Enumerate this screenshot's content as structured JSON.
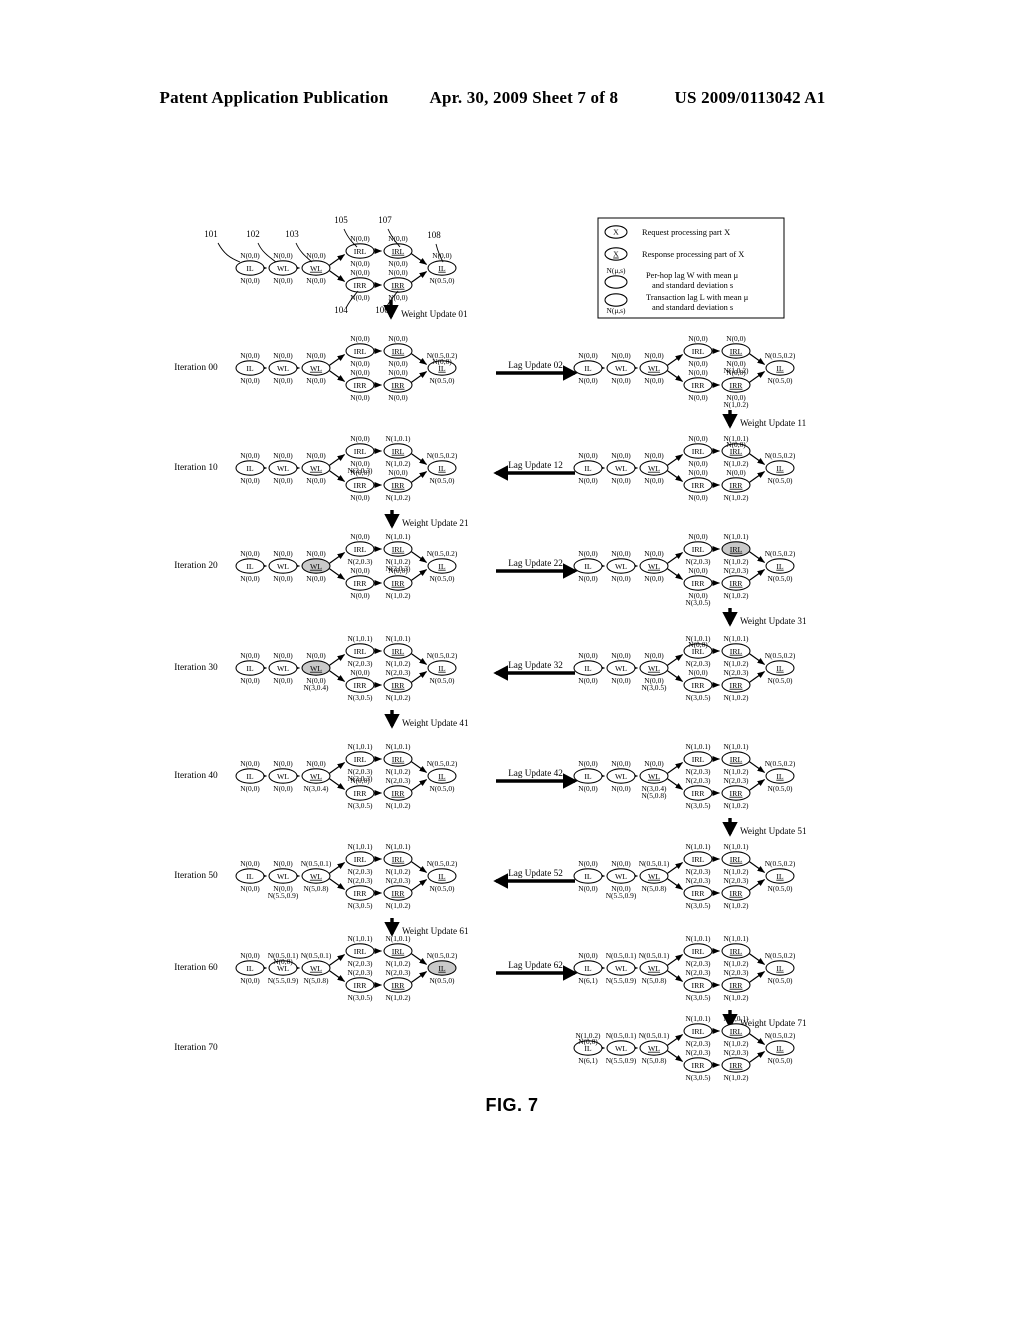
{
  "header": {
    "left": "Patent Application Publication",
    "middle": "Apr. 30, 2009  Sheet 7 of 8",
    "right": "US 2009/0113042 A1"
  },
  "figure": {
    "caption": "FIG. 7"
  },
  "legend": {
    "items": [
      {
        "glyph": "X",
        "underlined": false,
        "text": "Request processing part X"
      },
      {
        "glyph": "X",
        "underlined": true,
        "text": "Response processing part of X"
      },
      {
        "top_label": "N(μ,s)",
        "bottom_label": "",
        "text_line1": "Per-hop lag W with mean μ",
        "text_line2": "and standard deviation s"
      },
      {
        "top_label": "",
        "bottom_label": "N(μ,s)",
        "text_line1": "Transaction lag L with mean μ",
        "text_line2": "and standard deviation s"
      }
    ]
  },
  "reference_numerals": [
    "101",
    "102",
    "103",
    "104",
    "105",
    "106",
    "107",
    "108"
  ],
  "node_labels": {
    "il": "IL",
    "wl": "WL",
    "irl": "IRL",
    "irr": "IRR"
  },
  "updates": {
    "weight": [
      "Weight Update 01",
      "Weight Update 11",
      "Weight Update 21",
      "Weight Update 31",
      "Weight Update 41",
      "Weight Update 51",
      "Weight Update 61",
      "Weight Update 71"
    ],
    "lag": [
      {
        "label": "Lag Update 02",
        "direction": "right"
      },
      {
        "label": "Lag Update 12",
        "direction": "left"
      },
      {
        "label": "Lag Update 22",
        "direction": "right"
      },
      {
        "label": "Lag Update 32",
        "direction": "left"
      },
      {
        "label": "Lag Update 42",
        "direction": "right"
      },
      {
        "label": "Lag Update 52",
        "direction": "left"
      },
      {
        "label": "Lag Update 62",
        "direction": "right"
      }
    ]
  },
  "iterations": [
    {
      "label": "Iteration 00"
    },
    {
      "label": "Iteration 10"
    },
    {
      "label": "Iteration 20"
    },
    {
      "label": "Iteration 30"
    },
    {
      "label": "Iteration 40"
    },
    {
      "label": "Iteration 50"
    },
    {
      "label": "Iteration 60"
    },
    {
      "label": "Iteration 70"
    }
  ],
  "graphs": {
    "top": {
      "name": "initial-graph",
      "nodes": [
        {
          "id": "il1",
          "label": "IL",
          "top": "N(0,0)",
          "bottom": "N(0,0)",
          "underline": false,
          "shaded": false
        },
        {
          "id": "wl1",
          "label": "WL",
          "top": "N(0,0)",
          "bottom": "N(0,0)",
          "underline": false,
          "shaded": false
        },
        {
          "id": "wl2",
          "label": "WL",
          "top": "N(0,0)",
          "bottom": "N(0,0)",
          "underline": true,
          "shaded": false
        },
        {
          "id": "irl1",
          "label": "IRL",
          "top": "N(0,0)",
          "bottom": "N(0,0)",
          "underline": false,
          "shaded": false
        },
        {
          "id": "irl2",
          "label": "IRL",
          "top": "N(0,0)",
          "bottom": "N(0,0)",
          "underline": true,
          "shaded": false
        },
        {
          "id": "irr1",
          "label": "IRR",
          "top": "N(0,0)",
          "bottom": "N(0,0)",
          "underline": false,
          "shaded": false
        },
        {
          "id": "irr2",
          "label": "IRR",
          "top": "N(0,0)",
          "bottom": "N(0,0)",
          "underline": true,
          "shaded": false
        },
        {
          "id": "il2",
          "label": "IL",
          "top": "N(0,0)",
          "bottom": "N(0.5,0)",
          "underline": true,
          "shaded": false
        }
      ]
    },
    "rows": [
      {
        "iteration": "Iteration 00",
        "left": {
          "il1": {
            "top": "N(0,0)",
            "bottom": "N(0,0)"
          },
          "wl1": {
            "top": "N(0,0)",
            "bottom": "N(0,0)"
          },
          "wl2": {
            "top": "N(0,0)",
            "bottom": "N(0,0)"
          },
          "irl1": {
            "top": "N(0,0)",
            "bottom": "N(0,0)"
          },
          "irl2": {
            "top": "N(0,0)",
            "bottom": "N(0,0)"
          },
          "irr1": {
            "top": "N(0,0)",
            "bottom": "N(0,0)"
          },
          "irr2": {
            "top": "N(0,0)",
            "bottom": "N(0,0)"
          },
          "il2": {
            "top": "N(0.5,0.2)",
            "top2": "N(0,0)",
            "bottom": "N(0.5,0)"
          },
          "shaded": []
        },
        "right": {
          "il1": {
            "top": "N(0,0)",
            "bottom": "N(0,0)"
          },
          "wl1": {
            "top": "N(0,0)",
            "bottom": "N(0,0)"
          },
          "wl2": {
            "top": "N(0,0)",
            "bottom": "N(0,0)"
          },
          "irl1": {
            "top": "N(0,0)",
            "bottom": "N(0,0)"
          },
          "irl2": {
            "top": "N(0,0)",
            "bottom": "N(0,0)",
            "bottom2": "N(1,0.2)"
          },
          "irr1": {
            "top": "N(0,0)",
            "bottom": "N(0,0)"
          },
          "irr2": {
            "top": "N(0,0)",
            "bottom": "N(0,0)",
            "bottom2": "N(1,0.2)"
          },
          "il2": {
            "top": "N(0.5,0.2)",
            "bottom": "N(0.5,0)"
          },
          "shaded": []
        }
      },
      {
        "iteration": "Iteration 10",
        "left": {
          "il1": {
            "top": "N(0,0)",
            "bottom": "N(0,0)"
          },
          "wl1": {
            "top": "N(0,0)",
            "bottom": "N(0,0)"
          },
          "wl2": {
            "top": "N(0,0)",
            "bottom": "N(0,0)"
          },
          "irl1": {
            "top": "N(0,0)",
            "bottom": "N(0,0)",
            "bottom2": "N(2,0.3)"
          },
          "irl2": {
            "top": "N(1,0.1)",
            "bottom": "N(1,0.2)"
          },
          "irr1": {
            "top": "N(0,0)",
            "bottom": "N(0,0)"
          },
          "irr2": {
            "top": "N(0,0)",
            "bottom": "N(1,0.2)"
          },
          "il2": {
            "top": "N(0.5,0.2)",
            "bottom": "N(0.5,0)"
          },
          "shaded": []
        },
        "right": {
          "il1": {
            "top": "N(0,0)",
            "bottom": "N(0,0)"
          },
          "wl1": {
            "top": "N(0,0)",
            "bottom": "N(0,0)"
          },
          "wl2": {
            "top": "N(0,0)",
            "bottom": "N(0,0)"
          },
          "irl1": {
            "top": "N(0,0)",
            "bottom": "N(0,0)"
          },
          "irl2": {
            "top": "N(1,0.1)",
            "top2": "N(0,0)",
            "bottom": "N(1,0.2)"
          },
          "irr1": {
            "top": "N(0,0)",
            "bottom": "N(0,0)"
          },
          "irr2": {
            "top": "N(0,0)",
            "bottom": "N(1,0.2)"
          },
          "il2": {
            "top": "N(0.5,0.2)",
            "bottom": "N(0.5,0)"
          },
          "shaded": []
        }
      },
      {
        "iteration": "Iteration 20",
        "left": {
          "il1": {
            "top": "N(0,0)",
            "bottom": "N(0,0)"
          },
          "wl1": {
            "top": "N(0,0)",
            "bottom": "N(0,0)"
          },
          "wl2": {
            "top": "N(0,0)",
            "bottom": "N(0,0)"
          },
          "irl1": {
            "top": "N(0,0)",
            "bottom": "N(2,0.3)"
          },
          "irl2": {
            "top": "N(1,0.1)",
            "bottom": "N(1,0.2)",
            "bottom2": "N(2,0.3)"
          },
          "irr1": {
            "top": "N(0,0)",
            "bottom": "N(0,0)"
          },
          "irr2": {
            "top": "N(0,0)",
            "bottom": "N(1,0.2)"
          },
          "il2": {
            "top": "N(0.5,0.2)",
            "bottom": "N(0.5,0)"
          },
          "shaded": [
            "wl2"
          ]
        },
        "right": {
          "il1": {
            "top": "N(0,0)",
            "bottom": "N(0,0)"
          },
          "wl1": {
            "top": "N(0,0)",
            "bottom": "N(0,0)"
          },
          "wl2": {
            "top": "N(0,0)",
            "bottom": "N(0,0)"
          },
          "irl1": {
            "top": "N(0,0)",
            "bottom": "N(2,0.3)"
          },
          "irl2": {
            "top": "N(1,0.1)",
            "bottom": "N(1,0.2)"
          },
          "irr1": {
            "top": "N(0,0)",
            "bottom": "N(0,0)",
            "bottom2": "N(3,0.5)"
          },
          "irr2": {
            "top": "N(2,0.3)",
            "bottom": "N(1,0.2)"
          },
          "il2": {
            "top": "N(0.5,0.2)",
            "bottom": "N(0.5,0)"
          },
          "shaded": [
            "irl2"
          ]
        }
      },
      {
        "iteration": "Iteration 30",
        "left": {
          "il1": {
            "top": "N(0,0)",
            "bottom": "N(0,0)"
          },
          "wl1": {
            "top": "N(0,0)",
            "bottom": "N(0,0)"
          },
          "wl2": {
            "top": "N(0,0)",
            "bottom": "N(0,0)",
            "bottom2": "N(3,0.4)"
          },
          "irl1": {
            "top": "N(1,0.1)",
            "bottom": "N(2,0.3)"
          },
          "irl2": {
            "top": "N(1,0.1)",
            "bottom": "N(1,0.2)"
          },
          "irr1": {
            "top": "N(0,0)",
            "bottom": "N(3,0.5)"
          },
          "irr2": {
            "top": "N(2,0.3)",
            "bottom": "N(1,0.2)"
          },
          "il2": {
            "top": "N(0.5,0.2)",
            "bottom": "N(0.5,0)"
          },
          "shaded": [
            "wl2"
          ]
        },
        "right": {
          "il1": {
            "top": "N(0,0)",
            "bottom": "N(0,0)"
          },
          "wl1": {
            "top": "N(0,0)",
            "bottom": "N(0,0)"
          },
          "wl2": {
            "top": "N(0,0)",
            "bottom": "N(0,0)",
            "bottom2": "N(3,0.5)"
          },
          "irl1": {
            "top": "N(1,0.1)",
            "top2": "N(0,0)",
            "bottom": "N(2,0.3)"
          },
          "irl2": {
            "top": "N(1,0.1)",
            "bottom": "N(1,0.2)"
          },
          "irr1": {
            "top": "N(0,0)",
            "bottom": "N(3,0.5)"
          },
          "irr2": {
            "top": "N(2,0.3)",
            "bottom": "N(1,0.2)"
          },
          "il2": {
            "top": "N(0.5,0.2)",
            "bottom": "N(0.5,0)"
          },
          "shaded": []
        }
      },
      {
        "iteration": "Iteration 40",
        "left": {
          "il1": {
            "top": "N(0,0)",
            "bottom": "N(0,0)"
          },
          "wl1": {
            "top": "N(0,0)",
            "bottom": "N(0,0)"
          },
          "wl2": {
            "top": "N(0,0)",
            "bottom": "N(3,0.4)"
          },
          "irl1": {
            "top": "N(1,0.1)",
            "bottom": "N(2,0.3)",
            "bottom2": "N(2,0.3)"
          },
          "irl2": {
            "top": "N(1,0.1)",
            "bottom": "N(1,0.2)"
          },
          "irr1": {
            "top": "N(0,0)",
            "bottom": "N(3,0.5)"
          },
          "irr2": {
            "top": "N(2,0.3)",
            "bottom": "N(1,0.2)"
          },
          "il2": {
            "top": "N(0.5,0.2)",
            "bottom": "N(0.5,0)"
          },
          "shaded": []
        },
        "right": {
          "il1": {
            "top": "N(0,0)",
            "bottom": "N(0,0)"
          },
          "wl1": {
            "top": "N(0,0)",
            "bottom": "N(0,0)"
          },
          "wl2": {
            "top": "N(0,0)",
            "bottom": "N(3,0.4)",
            "bottom2": "N(5,0.8)"
          },
          "irl1": {
            "top": "N(1,0.1)",
            "bottom": "N(2,0.3)"
          },
          "irl2": {
            "top": "N(1,0.1)",
            "bottom": "N(1,0.2)"
          },
          "irr1": {
            "top": "N(2,0.3)",
            "bottom": "N(3,0.5)"
          },
          "irr2": {
            "top": "N(2,0.3)",
            "bottom": "N(1,0.2)"
          },
          "il2": {
            "top": "N(0.5,0.2)",
            "bottom": "N(0.5,0)"
          },
          "shaded": []
        }
      },
      {
        "iteration": "Iteration 50",
        "left": {
          "il1": {
            "top": "N(0,0)",
            "bottom": "N(0,0)"
          },
          "wl1": {
            "top": "N(0,0)",
            "bottom": "N(0,0)",
            "bottom2": "N(5.5,0.9)"
          },
          "wl2": {
            "top": "N(0.5,0.1)",
            "bottom": "N(5,0.8)"
          },
          "irl1": {
            "top": "N(1,0.1)",
            "bottom": "N(2,0.3)"
          },
          "irl2": {
            "top": "N(1,0.1)",
            "bottom": "N(1,0.2)"
          },
          "irr1": {
            "top": "N(2,0.3)",
            "bottom": "N(3,0.5)"
          },
          "irr2": {
            "top": "N(2,0.3)",
            "bottom": "N(1,0.2)"
          },
          "il2": {
            "top": "N(0.5,0.2)",
            "bottom": "N(0.5,0)"
          },
          "shaded": []
        },
        "right": {
          "il1": {
            "top": "N(0,0)",
            "bottom": "N(0,0)"
          },
          "wl1": {
            "top": "N(0,0)",
            "bottom": "N(0,0)",
            "bottom2": "N(5.5,0.9)"
          },
          "wl2": {
            "top": "N(0.5,0.1)",
            "bottom": "N(5,0.8)"
          },
          "irl1": {
            "top": "N(1,0.1)",
            "bottom": "N(2,0.3)"
          },
          "irl2": {
            "top": "N(1,0.1)",
            "bottom": "N(1,0.2)"
          },
          "irr1": {
            "top": "N(2,0.3)",
            "bottom": "N(3,0.5)"
          },
          "irr2": {
            "top": "N(2,0.3)",
            "bottom": "N(1,0.2)"
          },
          "il2": {
            "top": "N(0.5,0.2)",
            "bottom": "N(0.5,0)"
          },
          "shaded": []
        }
      },
      {
        "iteration": "Iteration 60",
        "left": {
          "il1": {
            "top": "N(0,0)",
            "bottom": "N(0,0)"
          },
          "wl1": {
            "top": "N(0.5,0.1)",
            "top2": "N(0,0)",
            "bottom": "N(5.5,0.9)"
          },
          "wl2": {
            "top": "N(0.5,0.1)",
            "bottom": "N(5,0.8)"
          },
          "irl1": {
            "top": "N(1,0.1)",
            "bottom": "N(2,0.3)"
          },
          "irl2": {
            "top": "N(1,0.1)",
            "bottom": "N(1,0.2)"
          },
          "irr1": {
            "top": "N(2,0.3)",
            "bottom": "N(3,0.5)"
          },
          "irr2": {
            "top": "N(2,0.3)",
            "bottom": "N(1,0.2)"
          },
          "il2": {
            "top": "N(0.5,0.2)",
            "bottom": "N(0.5,0)"
          },
          "shaded": [
            "il2"
          ]
        },
        "right": {
          "il1": {
            "top": "N(0,0)",
            "bottom": "N(6,1)"
          },
          "wl1": {
            "top": "N(0.5,0.1)",
            "bottom": "N(5.5,0.9)"
          },
          "wl2": {
            "top": "N(0.5,0.1)",
            "bottom": "N(5,0.8)"
          },
          "irl1": {
            "top": "N(1,0.1)",
            "bottom": "N(2,0.3)"
          },
          "irl2": {
            "top": "N(1,0.1)",
            "bottom": "N(1,0.2)"
          },
          "irr1": {
            "top": "N(2,0.3)",
            "bottom": "N(3,0.5)"
          },
          "irr2": {
            "top": "N(2,0.3)",
            "bottom": "N(1,0.2)"
          },
          "il2": {
            "top": "N(0.5,0.2)",
            "bottom": "N(0.5,0)"
          },
          "shaded": []
        }
      },
      {
        "iteration": "Iteration 70",
        "left": null,
        "right": {
          "il1": {
            "top": "N(1,0.2)",
            "top2": "N(0,0)",
            "bottom": "N(6,1)"
          },
          "wl1": {
            "top": "N(0.5,0.1)",
            "bottom": "N(5.5,0.9)"
          },
          "wl2": {
            "top": "N(0.5,0.1)",
            "bottom": "N(5,0.8)"
          },
          "irl1": {
            "top": "N(1,0.1)",
            "bottom": "N(2,0.3)"
          },
          "irl2": {
            "top": "N(1,0.1)",
            "bottom": "N(1,0.2)"
          },
          "irr1": {
            "top": "N(2,0.3)",
            "bottom": "N(3,0.5)"
          },
          "irr2": {
            "top": "N(2,0.3)",
            "bottom": "N(1,0.2)"
          },
          "il2": {
            "top": "N(0.5,0.2)",
            "bottom": "N(0.5,0)"
          },
          "shaded": []
        }
      }
    ]
  }
}
